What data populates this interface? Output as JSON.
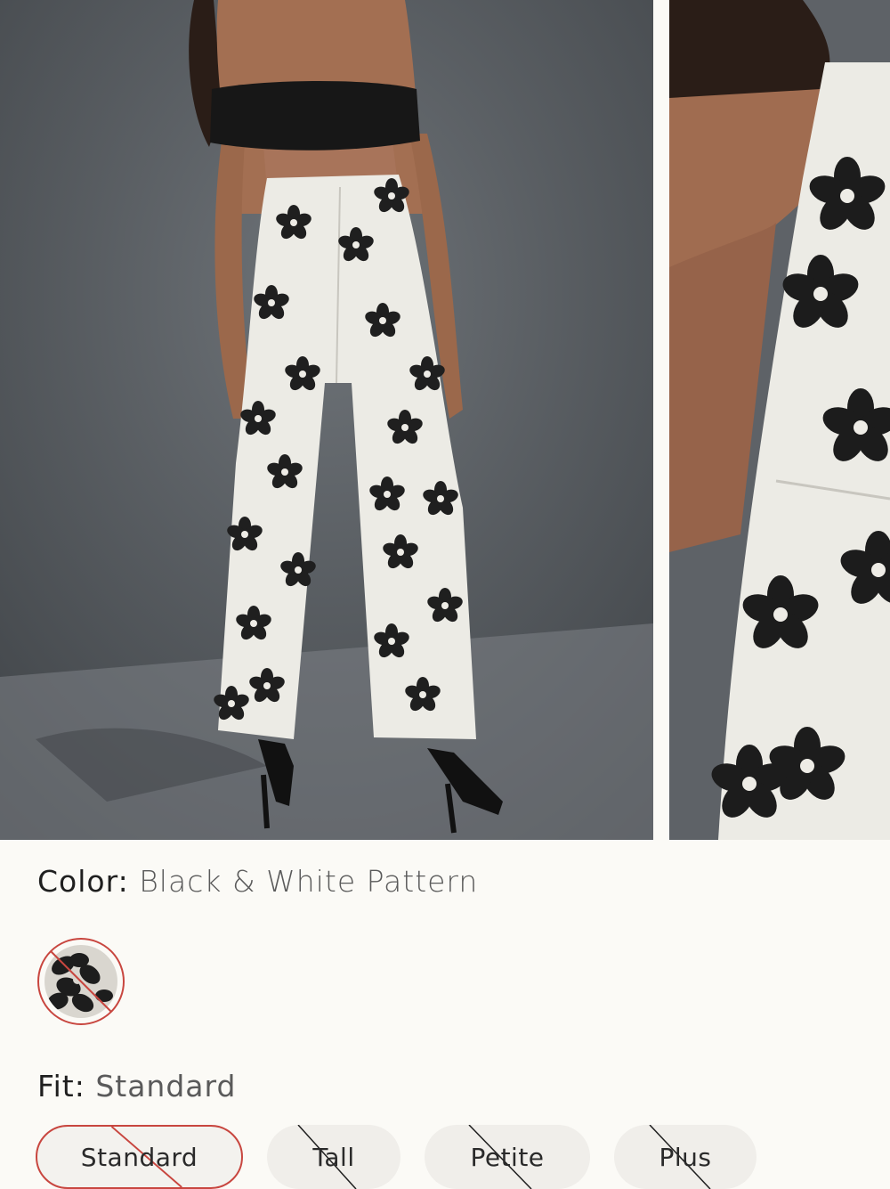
{
  "color": {
    "label": "Color:",
    "value": "Black & White Pattern",
    "accent": "#c8463f"
  },
  "swatch": {
    "name": "Black & White Pattern swatch",
    "unavailable": true
  },
  "fit": {
    "label": "Fit:",
    "value": "Standard",
    "options": [
      {
        "label": "Standard",
        "selected": true,
        "unavailable": true
      },
      {
        "label": "Tall",
        "selected": false,
        "unavailable": true
      },
      {
        "label": "Petite",
        "selected": false,
        "unavailable": true
      },
      {
        "label": "Plus",
        "selected": false,
        "unavailable": true
      }
    ]
  }
}
